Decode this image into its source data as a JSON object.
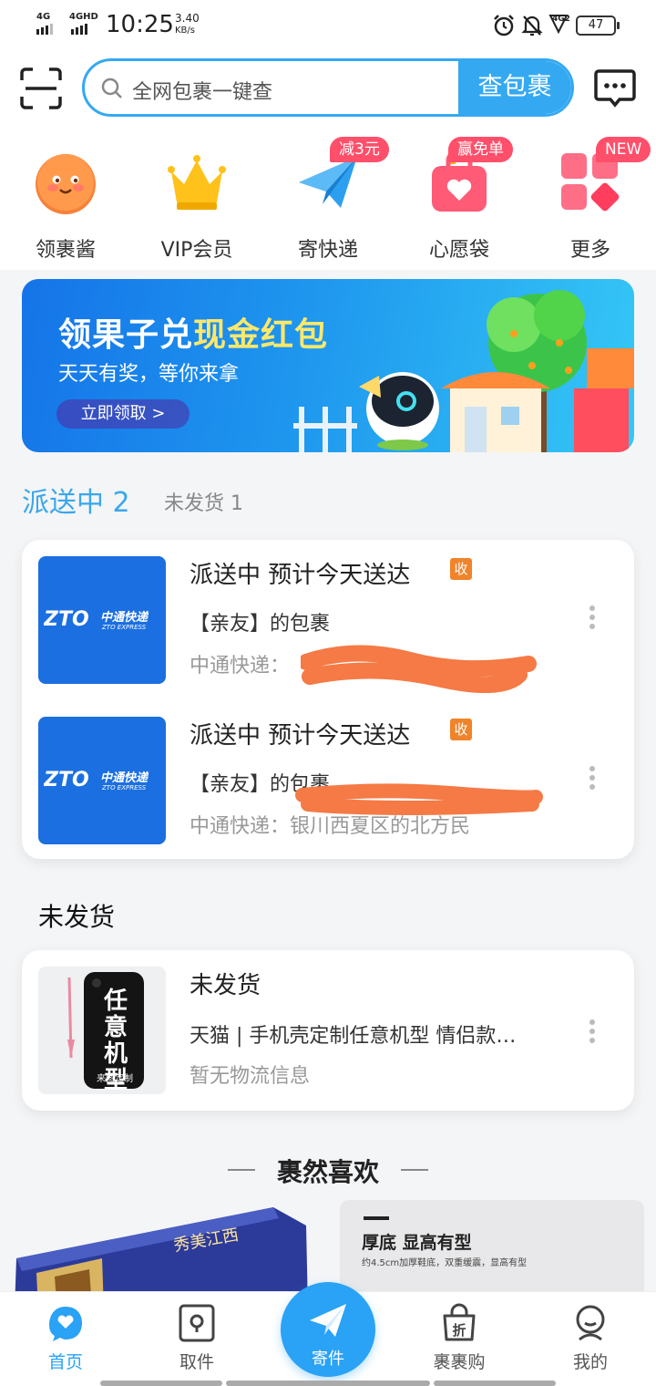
{
  "status_bar": {
    "signal1": "4G",
    "signal2": "4GHD",
    "time": "10:25",
    "speed_value": "3.40",
    "speed_unit": "KB/s",
    "net": "4G2",
    "battery": "47"
  },
  "header": {
    "search_placeholder": "全网包裹一键查",
    "search_button": "查包裹"
  },
  "quick_actions": [
    {
      "label": "领裹酱",
      "badge": ""
    },
    {
      "label": "VIP会员",
      "badge": ""
    },
    {
      "label": "寄快递",
      "badge": "减3元"
    },
    {
      "label": "心愿袋",
      "badge": "赢免单"
    },
    {
      "label": "更多",
      "badge": "NEW"
    }
  ],
  "banner": {
    "title_prefix": "领果子兑",
    "title_highlight": "现金红包",
    "subtitle": "天天有奖，等你来拿",
    "cta": "立即领取 >"
  },
  "tabs": {
    "active": "派送中 2",
    "inactive": "未发货 1"
  },
  "delivering": [
    {
      "logo_text": "中通快递",
      "logo_sub": "ZTO EXPRESS",
      "status": "派送中 预计今天送达",
      "tag": "收",
      "name": "【亲友】的包裹",
      "info": "中通快递："
    },
    {
      "logo_text": "中通快递",
      "logo_sub": "ZTO EXPRESS",
      "status": "派送中 预计今天送达",
      "tag": "收",
      "name": "【亲友】的包裹",
      "info": "中通快递：银川西夏区的北方民"
    }
  ],
  "unshipped_section": "未发货",
  "unshipped": {
    "status": "未发货",
    "name": "天猫 | 手机壳定制任意机型 情侣款…",
    "info": "暂无物流信息",
    "case_text": "任意机型",
    "case_sub": "来图定制"
  },
  "recommend": {
    "title": "裹然喜欢",
    "left_text": "秀美江西",
    "right_title": "厚底 显高有型",
    "right_sub": "约4.5cm加厚鞋底，双重缓震，显高有型"
  },
  "bottom_nav": [
    {
      "label": "首页",
      "active": true
    },
    {
      "label": "取件",
      "active": false
    },
    {
      "label": "寄件",
      "active": false
    },
    {
      "label": "裹裹购",
      "active": false
    },
    {
      "label": "我的",
      "active": false
    }
  ],
  "colors": {
    "accent": "#34a9f2",
    "badge": "#ff4f6a",
    "zto": "#1b6fe0",
    "tag": "#f0842a",
    "redaction": "#f57a45"
  }
}
